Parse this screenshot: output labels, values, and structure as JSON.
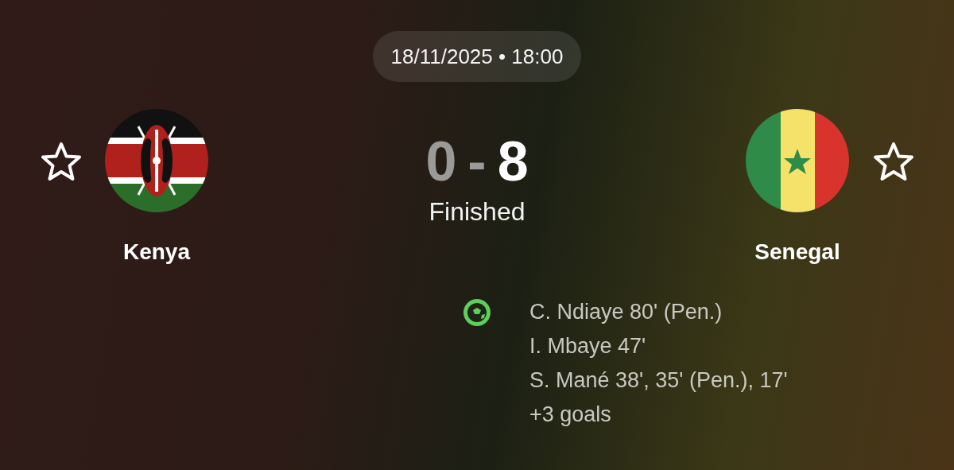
{
  "match_time": "18/11/2025 • 18:00",
  "teams": [
    {
      "name": "Kenya",
      "kind": "kenya",
      "favorite": false
    },
    {
      "name": "Senegal",
      "kind": "senegal",
      "favorite": false
    }
  ],
  "score": {
    "separator": "-",
    "sides": [
      {
        "value": "0",
        "leading": false
      },
      {
        "value": "8",
        "leading": true
      }
    ]
  },
  "status": "Finished",
  "scorers": [
    "C. Ndiaye 80' (Pen.)",
    "I. Mbaye 47'",
    "S. Mané 38', 35' (Pen.), 17'",
    "+3 goals"
  ]
}
